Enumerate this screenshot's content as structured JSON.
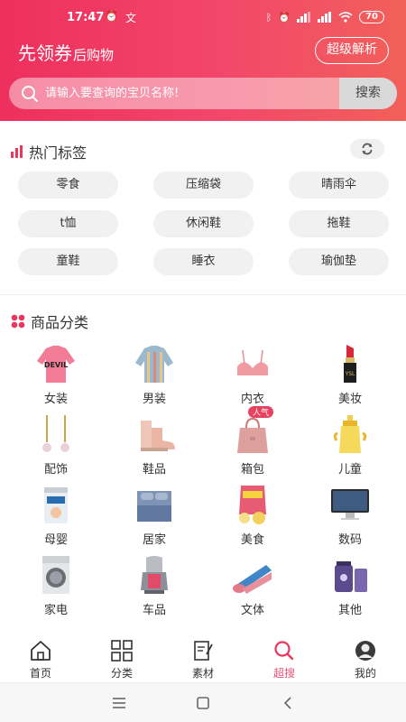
{
  "status_bar": {
    "time": "17:47",
    "battery": "70"
  },
  "header": {
    "brand_main": "先领券",
    "brand_sub": "后购物",
    "analysis_button": "超级解析",
    "search_placeholder": "请输入要查询的宝贝名称!",
    "search_button": "搜索"
  },
  "hot_tags": {
    "title": "热门标签",
    "tags": [
      "零食",
      "压缩袋",
      "晴雨伞",
      "t恤",
      "休闲鞋",
      "拖鞋",
      "童鞋",
      "睡衣",
      "瑜伽垫"
    ]
  },
  "categories": {
    "title": "商品分类",
    "badge": "人气",
    "items": [
      {
        "label": "女装",
        "icon": "sweater-pink-icon"
      },
      {
        "label": "男装",
        "icon": "sweater-striped-icon"
      },
      {
        "label": "内衣",
        "icon": "bra-icon"
      },
      {
        "label": "美妆",
        "icon": "lipstick-icon"
      },
      {
        "label": "配饰",
        "icon": "earrings-icon"
      },
      {
        "label": "鞋品",
        "icon": "boots-icon"
      },
      {
        "label": "箱包",
        "icon": "handbag-icon"
      },
      {
        "label": "儿童",
        "icon": "baby-bottle-icon"
      },
      {
        "label": "母婴",
        "icon": "formula-can-icon"
      },
      {
        "label": "居家",
        "icon": "bedding-icon"
      },
      {
        "label": "美食",
        "icon": "snack-icon"
      },
      {
        "label": "数码",
        "icon": "monitor-icon"
      },
      {
        "label": "家电",
        "icon": "washing-machine-icon"
      },
      {
        "label": "车品",
        "icon": "car-seat-icon"
      },
      {
        "label": "文体",
        "icon": "yoga-mat-icon"
      },
      {
        "label": "其他",
        "icon": "supplement-bottle-icon"
      }
    ]
  },
  "bottom_nav": {
    "items": [
      {
        "label": "首页",
        "icon": "home-icon"
      },
      {
        "label": "分类",
        "icon": "grid-icon"
      },
      {
        "label": "素材",
        "icon": "edit-note-icon"
      },
      {
        "label": "超搜",
        "icon": "search-icon",
        "active": true
      },
      {
        "label": "我的",
        "icon": "user-icon"
      }
    ]
  },
  "colors": {
    "header_start": "#ee2f5d",
    "header_end": "#f2605a",
    "active_nav": "#e9537a",
    "tag_bg": "#f1f1f1"
  }
}
